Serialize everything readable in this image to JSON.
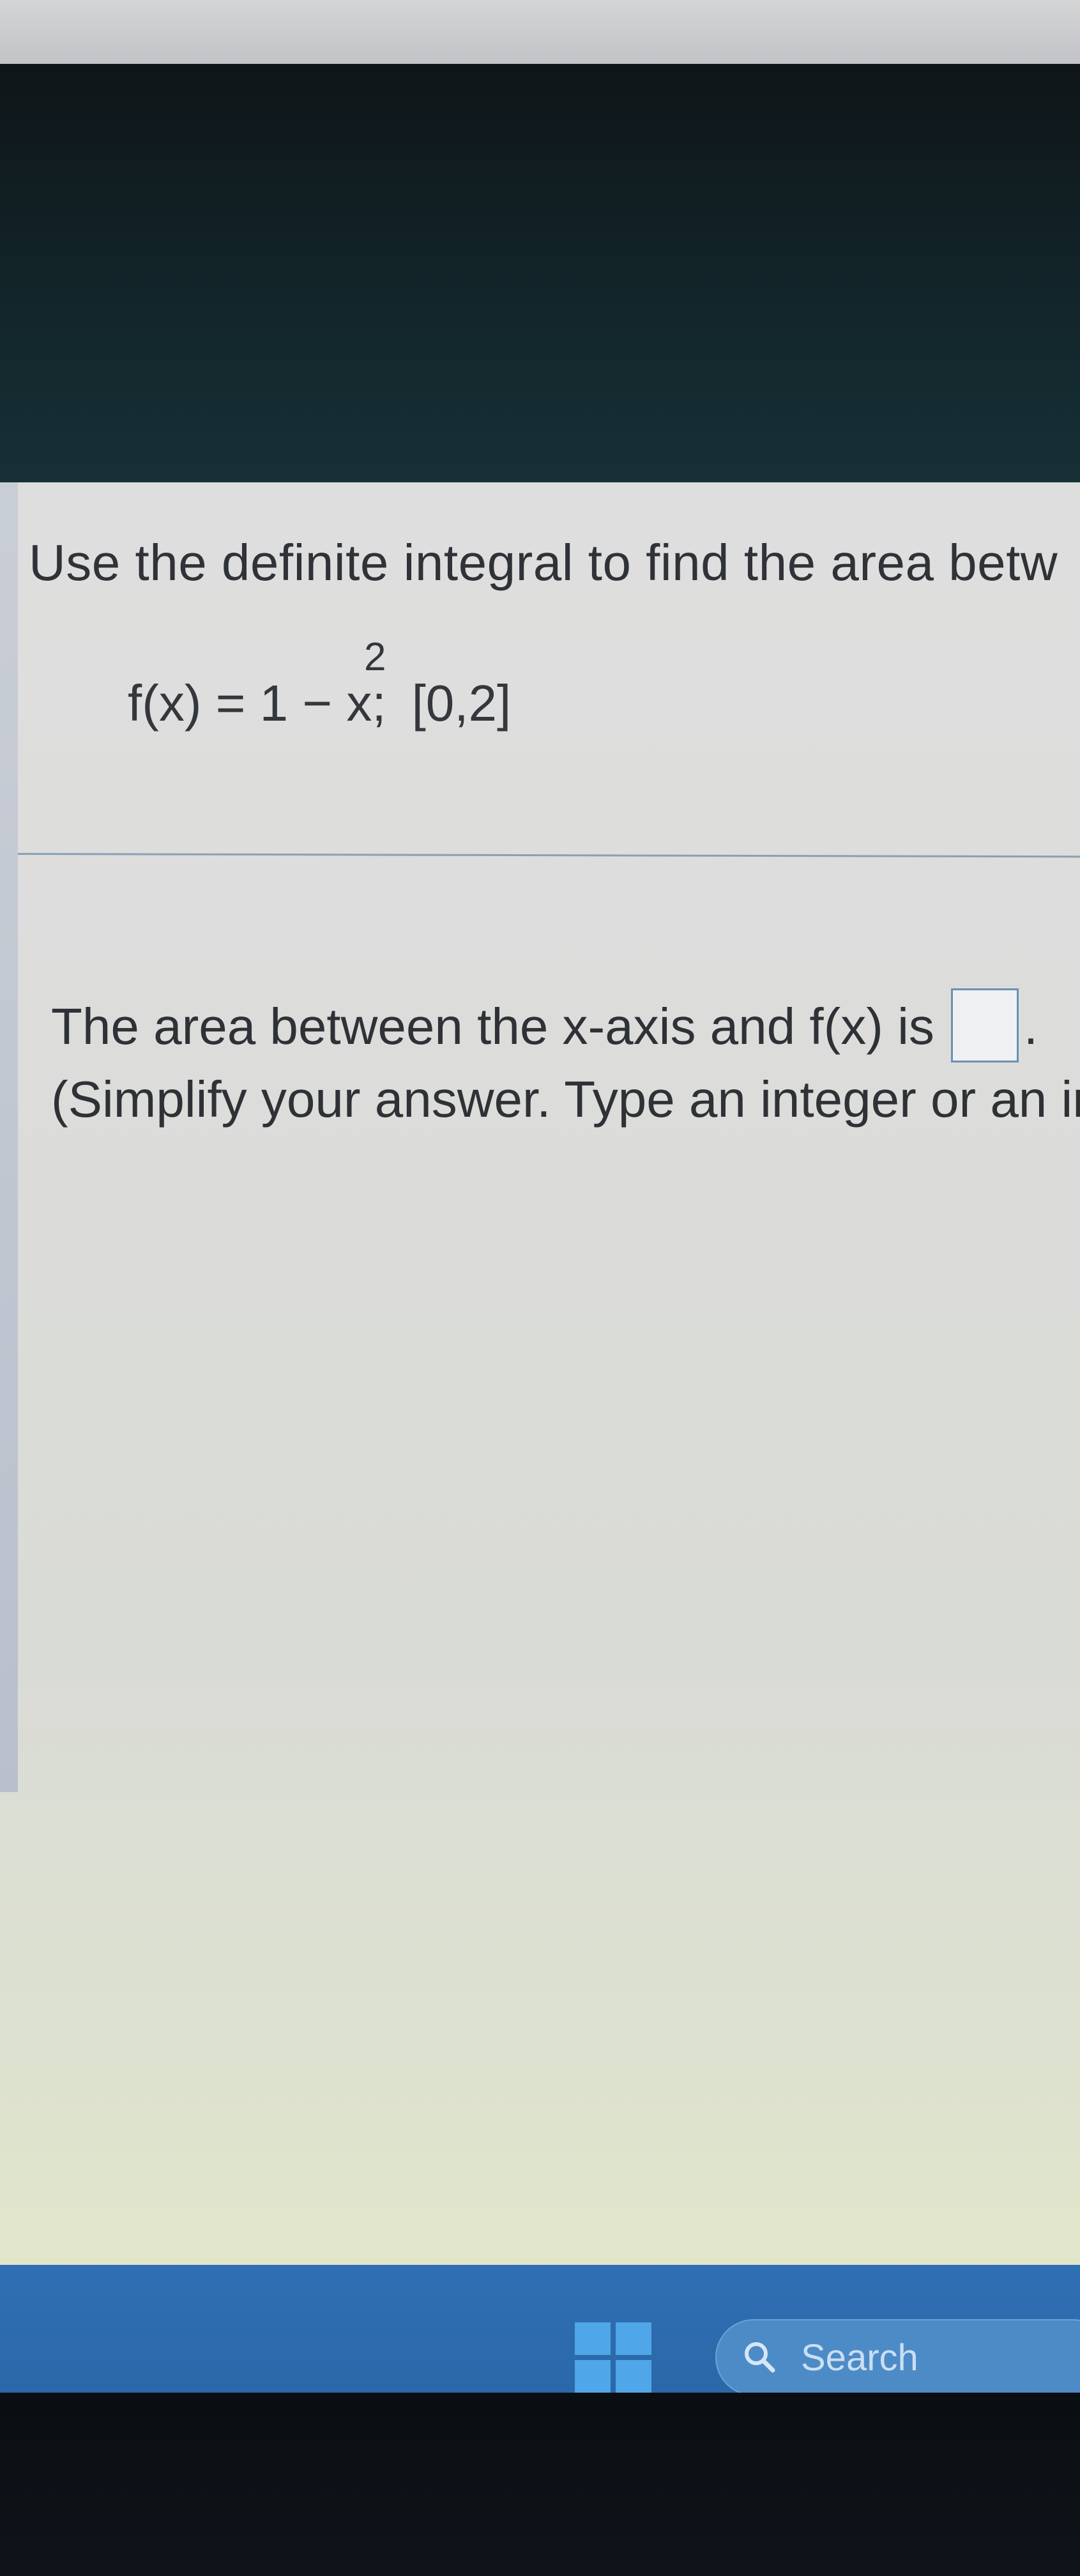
{
  "question": {
    "instruction": "Use the definite integral to find the area betw",
    "formula": {
      "lhs": "f(x) = 1 − x",
      "exponent": "2",
      "separator": ";",
      "interval": "[0,2]"
    },
    "answer_prompt": "The area between the x-axis and f(x) is",
    "answer_value": "",
    "answer_period": ".",
    "hint": "(Simplify your answer. Type an integer or an in"
  },
  "taskbar": {
    "start_icon": "windows-logo-icon",
    "search_icon": "search-icon",
    "search_label": "Search"
  },
  "colors": {
    "taskbar": "#2a68a9",
    "answer_box_border": "#6c8fb5"
  }
}
